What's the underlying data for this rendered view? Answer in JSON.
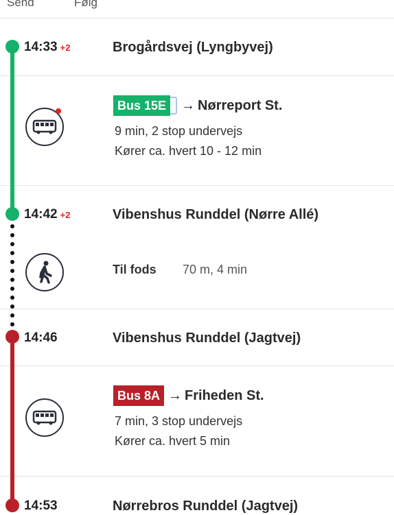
{
  "top_actions": {
    "send_label": "Send",
    "follow_label": "Følg"
  },
  "colors": {
    "line_green": "#16b16a",
    "line_red": "#b8212a",
    "delay_red": "#e02424",
    "live_dot": "#e02424"
  },
  "stops": [
    {
      "time": "14:33",
      "delay": "+2",
      "name": "Brogårdsvej (Lyngbyvej)"
    },
    {
      "time": "14:42",
      "delay": "+2",
      "name": "Vibenshus Runddel (Nørre Allé)"
    },
    {
      "time": "14:46",
      "delay": "",
      "name": "Vibenshus Runddel (Jagtvej)"
    },
    {
      "time": "14:53",
      "delay": "",
      "name": "Nørrebros Runddel (Jagtvej)"
    }
  ],
  "legs": [
    {
      "mode_icon": "bus-icon",
      "route": "Bus 15E",
      "arrow": "→",
      "destination": "Nørreport St.",
      "duration_stops": "9 min, 2 stop undervejs",
      "frequency": "Kører ca. hvert 10 - 12 min",
      "live": true
    },
    {
      "mode_icon": "walk-icon",
      "label": "Til fods",
      "detail": "70 m, 4 min"
    },
    {
      "mode_icon": "bus-icon",
      "route": "Bus 8A",
      "arrow": "→",
      "destination": "Friheden St.",
      "duration_stops": "7 min, 3 stop undervejs",
      "frequency": "Kører ca. hvert 5 min"
    }
  ]
}
